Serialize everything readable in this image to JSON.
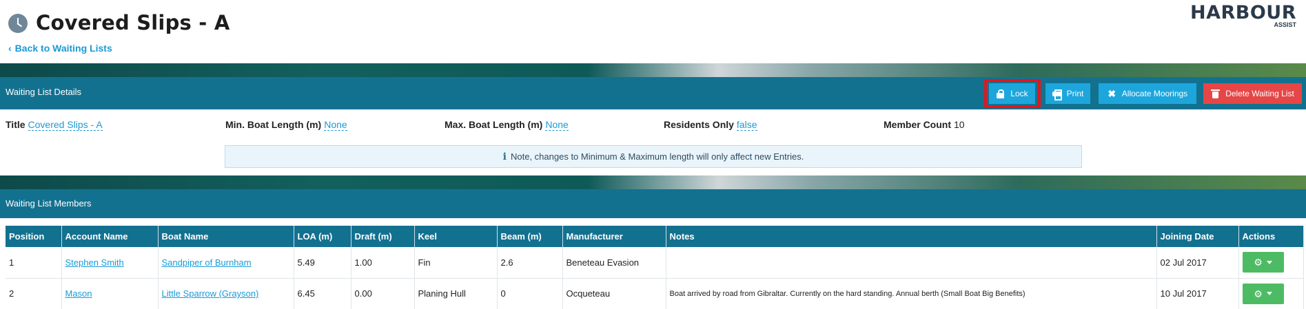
{
  "header": {
    "title": "Covered Slips - A",
    "back_label": "Back to Waiting Lists",
    "brand_name": "HARBOUR",
    "brand_sub": "ASSIST"
  },
  "details_bar": {
    "title": "Waiting List Details",
    "buttons": {
      "lock": "Lock",
      "print": "Print",
      "allocate": "Allocate Moorings",
      "delete": "Delete Waiting List"
    }
  },
  "details": {
    "title_label": "Title",
    "title_value": "Covered Slips - A",
    "min_label": "Min. Boat Length (m)",
    "min_value": "None",
    "max_label": "Max. Boat Length (m)",
    "max_value": "None",
    "residents_label": "Residents Only",
    "residents_value": "false",
    "count_label": "Member Count",
    "count_value": "10",
    "note": "Note, changes to Minimum & Maximum length will only affect new Entries."
  },
  "members_bar": {
    "title": "Waiting List Members"
  },
  "table": {
    "headers": [
      "Position",
      "Account Name",
      "Boat Name",
      "LOA (m)",
      "Draft (m)",
      "Keel",
      "Beam (m)",
      "Manufacturer",
      "Notes",
      "Joining Date",
      "Actions"
    ],
    "rows": [
      {
        "position": "1",
        "account": "Stephen Smith",
        "boat": "Sandpiper of Burnham",
        "loa": "5.49",
        "draft": "1.00",
        "keel": "Fin",
        "beam": "2.6",
        "manufacturer": "Beneteau Evasion",
        "notes": "",
        "joining": "02 Jul 2017"
      },
      {
        "position": "2",
        "account": "Mason",
        "boat": "Little Sparrow (Grayson)",
        "loa": "6.45",
        "draft": "0.00",
        "keel": "Planing Hull",
        "beam": "0",
        "manufacturer": "Ocqueteau",
        "notes": "Boat arrived by road from Gibraltar. Currently on the hard standing. Annual berth (Small Boat Big Benefits)",
        "joining": "10 Jul 2017"
      }
    ]
  },
  "colors": {
    "bar": "#137190",
    "link": "#1a9ad6",
    "button_blue": "#1da6dc",
    "button_red": "#e64646",
    "button_green": "#4dbb63",
    "highlight": "#e0171e"
  },
  "icons": [
    "clock-icon",
    "chevron-left-icon",
    "lock-icon",
    "print-icon",
    "allocate-icon",
    "trash-icon",
    "info-icon",
    "gear-icon",
    "caret-down-icon"
  ]
}
